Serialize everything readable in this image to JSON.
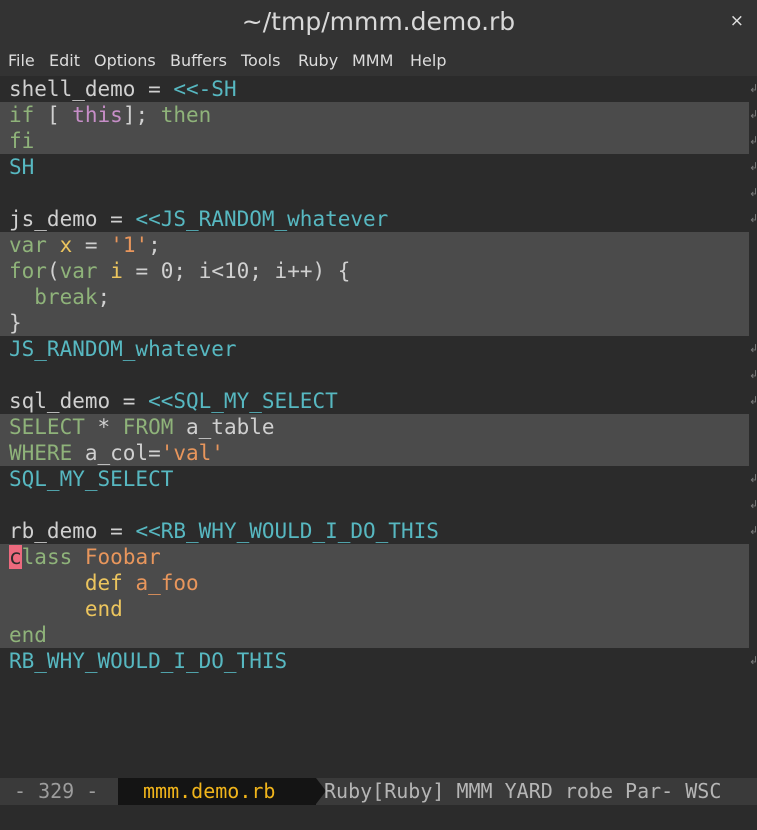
{
  "window": {
    "title": "~/tmp/mmm.demo.rb",
    "close_glyph": "×"
  },
  "menubar": {
    "items": [
      "File",
      "Edit",
      "Options",
      "Buffers",
      "Tools",
      "Ruby",
      "MMM",
      "Help"
    ]
  },
  "editor": {
    "fringe_glyph": "↲",
    "lines": [
      {
        "hl": false,
        "fringe": true,
        "spans": [
          [
            "w",
            "shell_demo = "
          ],
          [
            "cy",
            "<<-SH"
          ]
        ]
      },
      {
        "hl": true,
        "fringe": true,
        "spans": [
          [
            "g",
            "if"
          ],
          [
            "p",
            " [ "
          ],
          [
            "pu",
            "this"
          ],
          [
            "p",
            "]; "
          ],
          [
            "g",
            "then"
          ]
        ]
      },
      {
        "hl": true,
        "fringe": true,
        "spans": [
          [
            "g",
            "fi"
          ]
        ]
      },
      {
        "hl": false,
        "fringe": true,
        "spans": [
          [
            "cy",
            "SH"
          ]
        ]
      },
      {
        "hl": false,
        "fringe": true,
        "spans": []
      },
      {
        "hl": false,
        "fringe": true,
        "spans": [
          [
            "w",
            "js_demo = "
          ],
          [
            "cy",
            "<<JS_RANDOM_whatever"
          ]
        ]
      },
      {
        "hl": true,
        "fringe": false,
        "spans": [
          [
            "g",
            "var"
          ],
          [
            "p",
            " "
          ],
          [
            "y",
            "x"
          ],
          [
            "p",
            " = "
          ],
          [
            "o",
            "'1'"
          ],
          [
            "p",
            ";"
          ]
        ]
      },
      {
        "hl": true,
        "fringe": false,
        "spans": [
          [
            "g",
            "for"
          ],
          [
            "p",
            "("
          ],
          [
            "g",
            "var"
          ],
          [
            "p",
            " "
          ],
          [
            "y",
            "i"
          ],
          [
            "p",
            " = 0; i<10; i++) {"
          ]
        ]
      },
      {
        "hl": true,
        "fringe": false,
        "spans": [
          [
            "p",
            "  "
          ],
          [
            "g",
            "break"
          ],
          [
            "p",
            ";"
          ]
        ]
      },
      {
        "hl": true,
        "fringe": false,
        "spans": [
          [
            "p",
            "}"
          ]
        ]
      },
      {
        "hl": false,
        "fringe": true,
        "spans": [
          [
            "cy",
            "JS_RANDOM_whatever"
          ]
        ]
      },
      {
        "hl": false,
        "fringe": true,
        "spans": []
      },
      {
        "hl": false,
        "fringe": true,
        "spans": [
          [
            "w",
            "sql_demo = "
          ],
          [
            "cy",
            "<<SQL_MY_SELECT"
          ]
        ]
      },
      {
        "hl": true,
        "fringe": false,
        "spans": [
          [
            "g",
            "SELECT"
          ],
          [
            "p",
            " * "
          ],
          [
            "g",
            "FROM"
          ],
          [
            "p",
            " a_table"
          ]
        ]
      },
      {
        "hl": true,
        "fringe": false,
        "spans": [
          [
            "g",
            "WHERE"
          ],
          [
            "p",
            " a_col="
          ],
          [
            "o",
            "'val'"
          ]
        ]
      },
      {
        "hl": false,
        "fringe": true,
        "spans": [
          [
            "cy",
            "SQL_MY_SELECT"
          ]
        ]
      },
      {
        "hl": false,
        "fringe": true,
        "spans": []
      },
      {
        "hl": false,
        "fringe": true,
        "spans": [
          [
            "w",
            "rb_demo = "
          ],
          [
            "cy",
            "<<RB_WHY_WOULD_I_DO_THIS"
          ]
        ]
      },
      {
        "hl": true,
        "fringe": false,
        "spans": [
          [
            "cur",
            "c"
          ],
          [
            "g",
            "lass"
          ],
          [
            "p",
            " "
          ],
          [
            "o",
            "Foobar"
          ]
        ]
      },
      {
        "hl": true,
        "fringe": false,
        "spans": [
          [
            "p",
            "      "
          ],
          [
            "y",
            "def"
          ],
          [
            "p",
            " "
          ],
          [
            "o",
            "a_foo"
          ]
        ]
      },
      {
        "hl": true,
        "fringe": false,
        "spans": [
          [
            "p",
            "      "
          ],
          [
            "y",
            "end"
          ]
        ]
      },
      {
        "hl": true,
        "fringe": false,
        "spans": [
          [
            "g",
            "end"
          ]
        ]
      },
      {
        "hl": false,
        "fringe": true,
        "spans": [
          [
            "cy",
            "RB_WHY_WOULD_I_DO_THIS"
          ]
        ]
      }
    ]
  },
  "modeline": {
    "left": "- 329  -",
    "buffer": "mmm.demo.rb",
    "modes": "Ruby[Ruby] MMM YARD robe Par- WSC"
  },
  "colors": {
    "background": "#2b2b2b",
    "highlight_region": "#4b4b4b",
    "heredoc_delim": "#57b8c1",
    "keyword": "#8fb37a",
    "string": "#e8965c",
    "buffer_name": "#f0b41b",
    "cursor": "#ec6a7e"
  }
}
